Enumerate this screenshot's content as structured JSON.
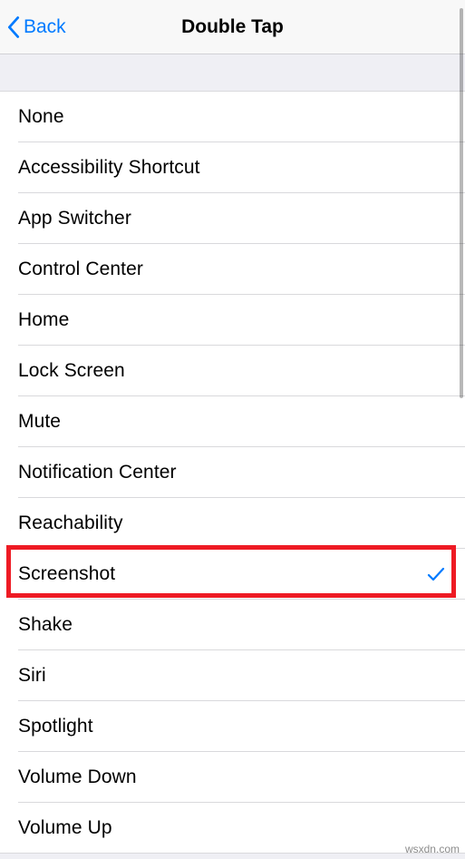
{
  "nav": {
    "back_label": "Back",
    "title": "Double Tap"
  },
  "options": [
    {
      "label": "None",
      "selected": false
    },
    {
      "label": "Accessibility Shortcut",
      "selected": false
    },
    {
      "label": "App Switcher",
      "selected": false
    },
    {
      "label": "Control Center",
      "selected": false
    },
    {
      "label": "Home",
      "selected": false
    },
    {
      "label": "Lock Screen",
      "selected": false
    },
    {
      "label": "Mute",
      "selected": false
    },
    {
      "label": "Notification Center",
      "selected": false
    },
    {
      "label": "Reachability",
      "selected": false
    },
    {
      "label": "Screenshot",
      "selected": true
    },
    {
      "label": "Shake",
      "selected": false
    },
    {
      "label": "Siri",
      "selected": false
    },
    {
      "label": "Spotlight",
      "selected": false
    },
    {
      "label": "Volume Down",
      "selected": false
    },
    {
      "label": "Volume Up",
      "selected": false
    }
  ],
  "highlight_index": 9,
  "watermark": "wsxdn.com"
}
